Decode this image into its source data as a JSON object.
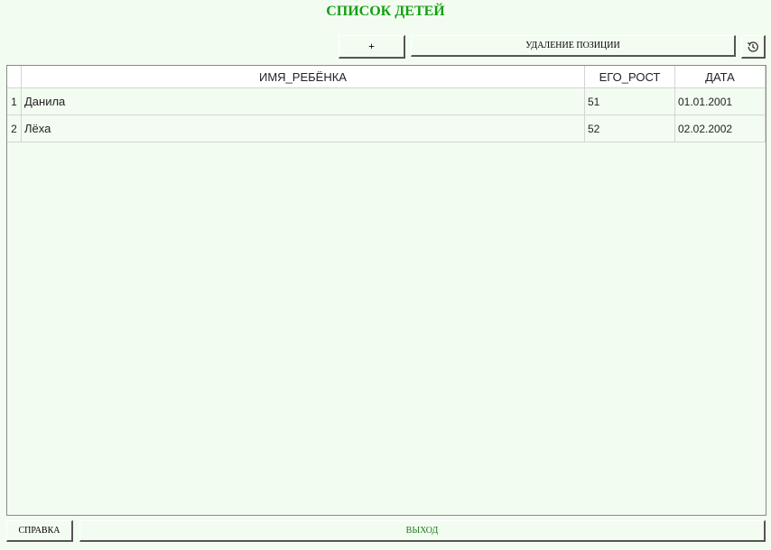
{
  "title": "СПИСОК ДЕТЕЙ",
  "toolbar": {
    "add_label": "+",
    "delete_label": "УДАЛЕНИЕ ПОЗИЦИИ",
    "history_icon": "history-icon"
  },
  "table": {
    "columns": [
      "ИМЯ_РЕБЁНКА",
      "ЕГО_РОСТ",
      "ДАТА"
    ],
    "rows": [
      {
        "num": "1",
        "name": "Данила",
        "height": "51",
        "date": "01.01.2001"
      },
      {
        "num": "2",
        "name": "Лёха",
        "height": "52",
        "date": "02.02.2002"
      }
    ]
  },
  "footer": {
    "help_label": "СПРАВКА",
    "exit_label": "ВЫХОД"
  },
  "colors": {
    "title": "#12a012",
    "background": "#f3fcf1",
    "exit_text": "#1a7a1a"
  }
}
